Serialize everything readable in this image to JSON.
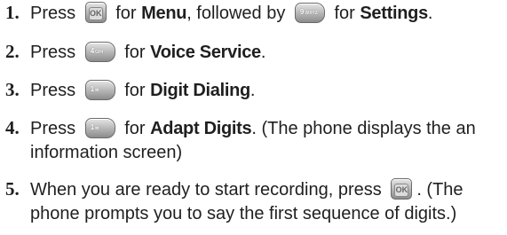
{
  "steps": [
    {
      "num": "1.",
      "press": "Press",
      "k1": "menu-ok-key",
      "t1": "for",
      "b1": "Menu",
      "t2": ", followed by",
      "k2": "9-wxyz-key",
      "k2_digit": "9",
      "k2_letters": "WXYZ",
      "t3": "for",
      "b2": "Settings",
      "t4": "."
    },
    {
      "num": "2.",
      "press": "Press",
      "k1": "4-ghi-key",
      "k1_digit": "4",
      "k1_letters": "GHI",
      "t1": "for",
      "b1": "Voice Service",
      "t2": "."
    },
    {
      "num": "3.",
      "press": "Press",
      "k1": "1-voicemail-key",
      "k1_digit": "1",
      "k1_letters": "✉",
      "t1": "for",
      "b1": "Digit Dialing",
      "t2": "."
    },
    {
      "num": "4.",
      "press": "Press",
      "k1": "1-voicemail-key",
      "k1_digit": "1",
      "k1_letters": "✉",
      "t1": "for",
      "b1": "Adapt Digits",
      "t2": ". (The phone displays the an",
      "line2": "information screen)"
    },
    {
      "num": "5.",
      "line1": "When you are ready to start recording, press",
      "k1": "menu-ok-key",
      "t1": ". (The",
      "line2": "phone prompts you to say the first sequence of digits.)"
    }
  ]
}
